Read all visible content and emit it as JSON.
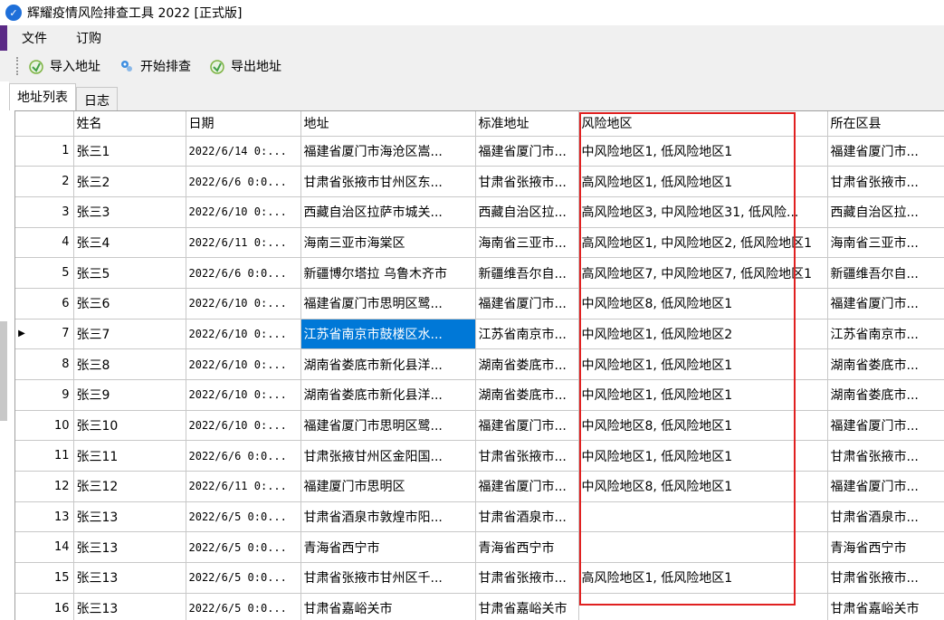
{
  "window": {
    "title": "辉耀疫情风险排查工具 2022 [正式版]"
  },
  "menu": [
    "文件",
    "订购"
  ],
  "toolbar": {
    "import_label": "导入地址",
    "start_label": "开始排查",
    "export_label": "导出地址"
  },
  "tabs": [
    "地址列表",
    "日志"
  ],
  "table": {
    "columns": [
      "姓名",
      "日期",
      "地址",
      "标准地址",
      "风险地区",
      "所在区县"
    ],
    "rows": [
      {
        "n": "1",
        "name": "张三1",
        "date": "2022/6/14 0:...",
        "addr": "福建省厦门市海沧区嵩...",
        "std": "福建省厦门市...",
        "risk": "中风险地区1, 低风险地区1",
        "county": "福建省厦门市..."
      },
      {
        "n": "2",
        "name": "张三2",
        "date": "2022/6/6 0:0...",
        "addr": "甘肃省张掖市甘州区东...",
        "std": "甘肃省张掖市...",
        "risk": "高风险地区1, 低风险地区1",
        "county": "甘肃省张掖市..."
      },
      {
        "n": "3",
        "name": "张三3",
        "date": "2022/6/10 0:...",
        "addr": "西藏自治区拉萨市城关...",
        "std": "西藏自治区拉...",
        "risk": "高风险地区3, 中风险地区31, 低风险...",
        "county": "西藏自治区拉..."
      },
      {
        "n": "4",
        "name": "张三4",
        "date": "2022/6/11 0:...",
        "addr": "海南三亚市海棠区",
        "std": "海南省三亚市...",
        "risk": "高风险地区1, 中风险地区2, 低风险地区1",
        "county": "海南省三亚市..."
      },
      {
        "n": "5",
        "name": "张三5",
        "date": "2022/6/6 0:0...",
        "addr": "新疆博尔塔拉 乌鲁木齐市",
        "std": "新疆维吾尔自...",
        "risk": "高风险地区7, 中风险地区7, 低风险地区1",
        "county": "新疆维吾尔自..."
      },
      {
        "n": "6",
        "name": "张三6",
        "date": "2022/6/10 0:...",
        "addr": "福建省厦门市思明区鹭...",
        "std": "福建省厦门市...",
        "risk": "中风险地区8, 低风险地区1",
        "county": "福建省厦门市..."
      },
      {
        "n": "7",
        "name": "张三7",
        "date": "2022/6/10 0:...",
        "addr": "江苏省南京市鼓楼区水...",
        "std": "江苏省南京市...",
        "risk": "中风险地区1, 低风险地区2",
        "county": "江苏省南京市..."
      },
      {
        "n": "8",
        "name": "张三8",
        "date": "2022/6/10 0:...",
        "addr": "湖南省娄底市新化县洋...",
        "std": "湖南省娄底市...",
        "risk": "中风险地区1, 低风险地区1",
        "county": "湖南省娄底市..."
      },
      {
        "n": "9",
        "name": "张三9",
        "date": "2022/6/10 0:...",
        "addr": "湖南省娄底市新化县洋...",
        "std": "湖南省娄底市...",
        "risk": "中风险地区1, 低风险地区1",
        "county": "湖南省娄底市..."
      },
      {
        "n": "10",
        "name": "张三10",
        "date": "2022/6/10 0:...",
        "addr": "福建省厦门市思明区鹭...",
        "std": "福建省厦门市...",
        "risk": "中风险地区8, 低风险地区1",
        "county": "福建省厦门市..."
      },
      {
        "n": "11",
        "name": "张三11",
        "date": "2022/6/6 0:0...",
        "addr": "甘肃张掖甘州区金阳国...",
        "std": "甘肃省张掖市...",
        "risk": "中风险地区1, 低风险地区1",
        "county": "甘肃省张掖市..."
      },
      {
        "n": "12",
        "name": "张三12",
        "date": "2022/6/11 0:...",
        "addr": "福建厦门市思明区",
        "std": "福建省厦门市...",
        "risk": "中风险地区8, 低风险地区1",
        "county": "福建省厦门市..."
      },
      {
        "n": "13",
        "name": "张三13",
        "date": "2022/6/5 0:0...",
        "addr": "甘肃省酒泉市敦煌市阳...",
        "std": "甘肃省酒泉市...",
        "risk": "",
        "county": "甘肃省酒泉市..."
      },
      {
        "n": "14",
        "name": "张三13",
        "date": "2022/6/5 0:0...",
        "addr": "青海省西宁市",
        "std": "青海省西宁市",
        "risk": "",
        "county": "青海省西宁市"
      },
      {
        "n": "15",
        "name": "张三13",
        "date": "2022/6/5 0:0...",
        "addr": "甘肃省张掖市甘州区千...",
        "std": "甘肃省张掖市...",
        "risk": "高风险地区1, 低风险地区1",
        "county": "甘肃省张掖市..."
      },
      {
        "n": "16",
        "name": "张三13",
        "date": "2022/6/5 0:0...",
        "addr": "甘肃省嘉峪关市",
        "std": "甘肃省嘉峪关市",
        "risk": "",
        "county": "甘肃省嘉峪关市"
      }
    ]
  }
}
